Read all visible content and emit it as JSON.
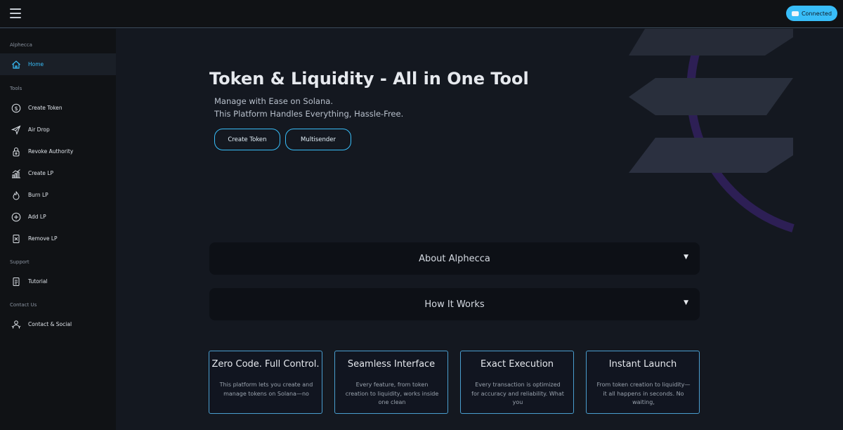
{
  "topbar": {
    "connect_label": "Connected"
  },
  "sidebar": {
    "sections": {
      "brand": "Alphecca",
      "tools": "Tools",
      "support": "Support",
      "contact": "Contact Us"
    },
    "items": [
      {
        "label": "Home",
        "icon": "home-icon",
        "active": true
      },
      {
        "label": "Create Token",
        "icon": "dollar-icon"
      },
      {
        "label": "Air Drop",
        "icon": "send-icon"
      },
      {
        "label": "Revoke Authority",
        "icon": "lock-icon"
      },
      {
        "label": "Create LP",
        "icon": "chart-icon"
      },
      {
        "label": "Burn LP",
        "icon": "flame-icon"
      },
      {
        "label": "Add LP",
        "icon": "plus-circle-icon"
      },
      {
        "label": "Remove LP",
        "icon": "remove-file-icon"
      },
      {
        "label": "Tutorial",
        "icon": "document-icon"
      },
      {
        "label": "Contact & Social",
        "icon": "users-icon"
      }
    ]
  },
  "hero": {
    "title": "Token & Liquidity - All in One Tool",
    "subtitle_line1": "Manage with Ease on Solana.",
    "subtitle_line2": "This Platform Handles Everything, Hassle-Free.",
    "primary_button": "Create Token",
    "secondary_button": "Multisender"
  },
  "accordions": [
    {
      "title": "About Alphecca",
      "arrow": "▼"
    },
    {
      "title": "How It Works",
      "arrow": "▼"
    }
  ],
  "cards": [
    {
      "title": "Zero Code. Full Control.",
      "body": "This platform lets you create and manage tokens on Solana—no"
    },
    {
      "title": "Seamless Interface",
      "body": "Every feature, from token creation to liquidity, works inside one clean"
    },
    {
      "title": "Exact Execution",
      "body": "Every transaction is optimized for accuracy and reliability. What you"
    },
    {
      "title": "Instant Launch",
      "body": "From token creation to liquidity—it all happens in seconds. No waiting,"
    }
  ],
  "colors": {
    "accent": "#38bdf8",
    "background": "#141820",
    "sidebar": "#101215",
    "logo_purple": "#3a2468",
    "logo_bar": "#272c38"
  }
}
